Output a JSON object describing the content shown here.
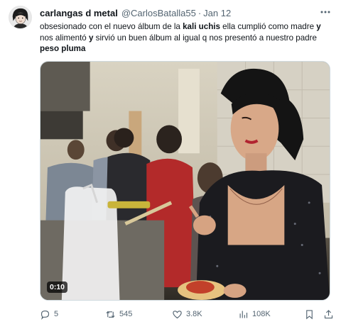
{
  "tweet": {
    "display_name": "carlangas d metal",
    "handle": "@CarlosBatalla55",
    "separator": "·",
    "time": "Jan 12",
    "text": {
      "part1": "obsesionado con el nuevo álbum de la ",
      "bold1": "kali uchis",
      "part2": " ella cumplió como madre ",
      "bold2": "y",
      "part3": " nos alimentó ",
      "bold3": "y",
      "part4": " sirvió un buen álbum al igual q nos presentó a nuestro padre ",
      "bold4": "peso pluma"
    },
    "media": {
      "duration": "0:10"
    },
    "actions": {
      "replies": "5",
      "retweets": "545",
      "likes": "3.8K",
      "views": "108K"
    }
  },
  "icons": {
    "more": "more-dots-icon",
    "reply": "reply-bubble-icon",
    "retweet": "retweet-arrows-icon",
    "like": "heart-icon",
    "views": "bar-chart-icon",
    "bookmark": "bookmark-icon",
    "share": "share-upload-icon"
  },
  "colors": {
    "text": "#0f1419",
    "muted": "#536471",
    "border": "#cfd9de"
  }
}
